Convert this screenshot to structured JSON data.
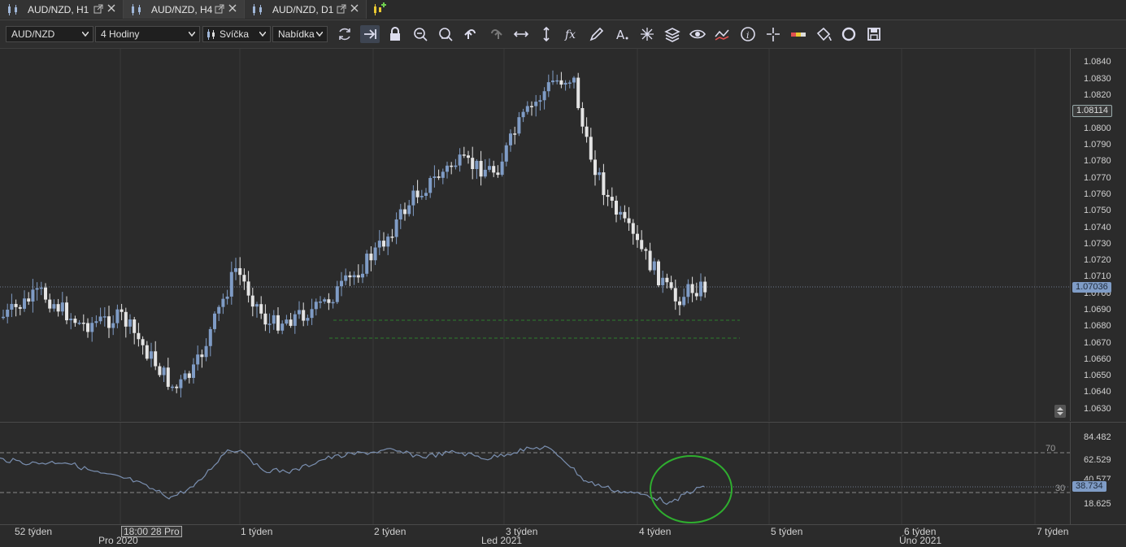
{
  "tabs": [
    {
      "label": "AUD/NZD, H1"
    },
    {
      "label": "AUD/NZD, H4"
    },
    {
      "label": "AUD/NZD, D1"
    }
  ],
  "toolbar": {
    "symbol": "AUD/NZD",
    "period": "4 Hodiny",
    "chart_type": "Svíčka",
    "menu": "Nabídka",
    "icons": [
      "refresh-icon",
      "autoscroll-icon",
      "lock-icon",
      "zoom-in-icon",
      "zoom-out-icon",
      "undo-icon",
      "redo-icon",
      "horizontal-fit-icon",
      "vertical-fit-icon",
      "indicator-fx-icon",
      "pencil-icon",
      "text-icon",
      "crosshair-icon",
      "layers-icon",
      "eye-icon",
      "chart-compare-icon",
      "info-icon",
      "cursor-cross-icon",
      "color-bar-icon",
      "fill-bucket-icon",
      "circle-icon",
      "save-icon"
    ]
  },
  "price_axis": {
    "ticks": [
      "1.0840",
      "1.0830",
      "1.0820",
      "1.0800",
      "1.0790",
      "1.0780",
      "1.0770",
      "1.0760",
      "1.0750",
      "1.0740",
      "1.0730",
      "1.0720",
      "1.0710",
      "1.0700",
      "1.0690",
      "1.0680",
      "1.0670",
      "1.0660",
      "1.0650",
      "1.0640",
      "1.0630"
    ],
    "high_tag": "1.08114",
    "current_tag": "1.07036"
  },
  "rsi_axis": {
    "ticks": [
      "84.482",
      "62.529",
      "18.625"
    ],
    "current_tag": "38.734",
    "partial_tick": "40.577",
    "level_70": "70",
    "level_30": "30"
  },
  "time_axis": {
    "week_labels": [
      "52 týden",
      "1 týden",
      "2 týden",
      "3 týden",
      "4 týden",
      "5 týden",
      "6 týden",
      "7 týden"
    ],
    "crosshair_label": "18:00 28 Pro",
    "month_labels": [
      "Pro 2020",
      "Led 2021",
      "Úno 2021"
    ]
  },
  "colors": {
    "bull": "#7f9cc6",
    "bear": "#e4e4e4",
    "rsi_line": "#7a8fb0",
    "annotation_circle": "#2fae2f",
    "support_line": "#2e7d2e",
    "current_tag_bg": "#7f9cc6"
  }
}
